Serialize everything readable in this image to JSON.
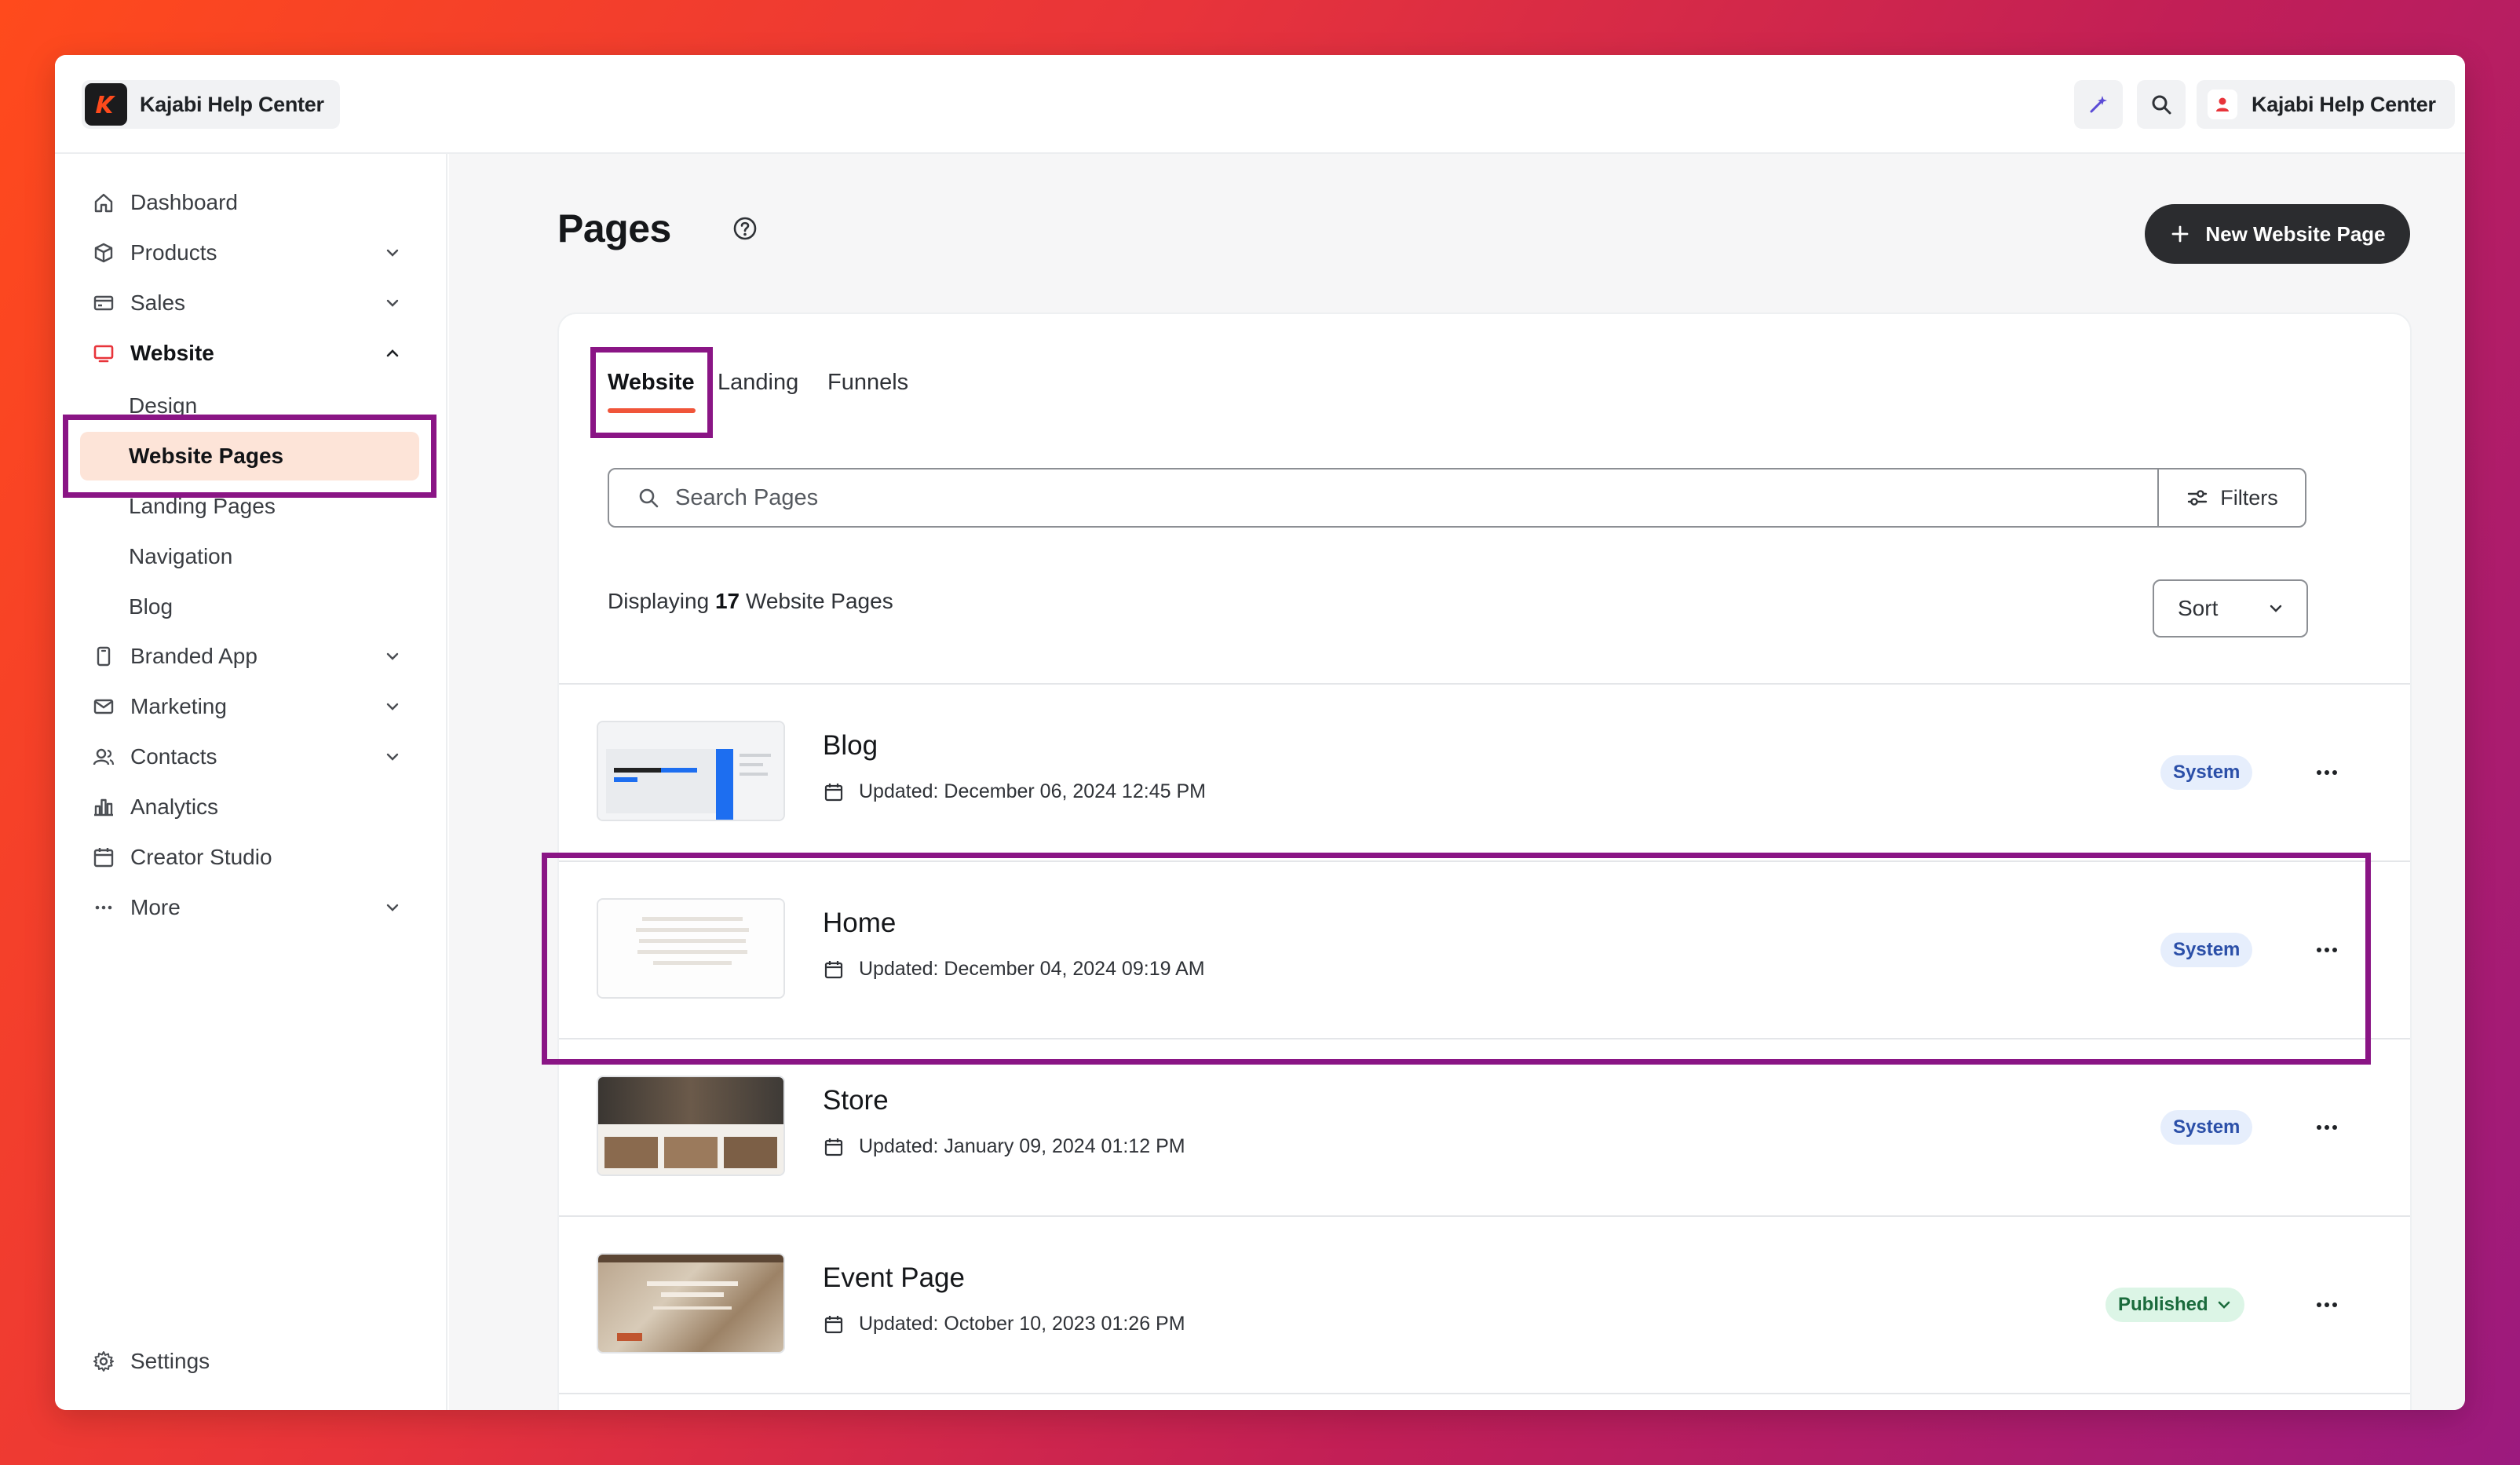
{
  "colors": {
    "accent": "#f0553a",
    "highlight": "#8a1585",
    "selected_bg": "#fde4d8",
    "system_badge": "#e6eefc",
    "published_badge": "#dcf5e6"
  },
  "header": {
    "site_name": "Kajabi Help Center",
    "account_name": "Kajabi Help Center",
    "ai_icon": "sparkle-icon",
    "search_icon": "search-icon"
  },
  "sidebar": {
    "items": [
      {
        "label": "Dashboard",
        "icon": "home-icon"
      },
      {
        "label": "Products",
        "icon": "box-icon"
      },
      {
        "label": "Sales",
        "icon": "card-icon"
      },
      {
        "label": "Website",
        "icon": "monitor-icon"
      },
      {
        "label": "Branded App",
        "icon": "phone-icon"
      },
      {
        "label": "Marketing",
        "icon": "mail-icon"
      },
      {
        "label": "Contacts",
        "icon": "people-icon"
      },
      {
        "label": "Analytics",
        "icon": "chart-icon"
      },
      {
        "label": "Creator Studio",
        "icon": "calendar-icon"
      },
      {
        "label": "More",
        "icon": "more-icon"
      }
    ],
    "website_sub": [
      "Design",
      "Website Pages",
      "Landing Pages",
      "Navigation",
      "Blog"
    ],
    "settings": "Settings"
  },
  "main": {
    "title": "Pages",
    "new_button": "New Website Page",
    "tabs": [
      "Website",
      "Landing",
      "Funnels"
    ],
    "search_placeholder": "Search Pages",
    "filters_label": "Filters",
    "display_prefix": "Displaying",
    "display_count": "17",
    "display_suffix": "Website Pages",
    "sort_label": "Sort",
    "rows": [
      {
        "title": "Blog",
        "updated": "Updated: December 06, 2024 12:45 PM",
        "status": "System"
      },
      {
        "title": "Home",
        "updated": "Updated: December 04, 2024 09:19 AM",
        "status": "System"
      },
      {
        "title": "Store",
        "updated": "Updated: January 09, 2024 01:12 PM",
        "status": "System"
      },
      {
        "title": "Event Page",
        "updated": "Updated: October 10, 2023 01:26 PM",
        "status": "Published"
      }
    ]
  }
}
